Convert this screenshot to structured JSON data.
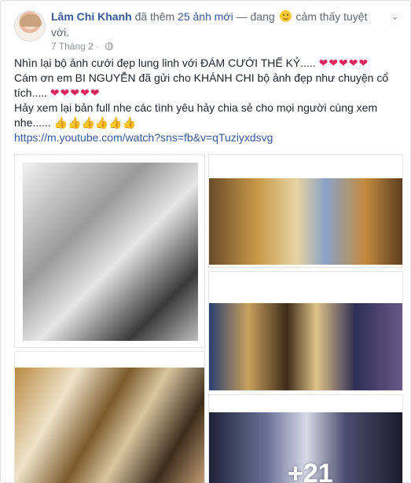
{
  "post": {
    "author": "Lâm Chi Khanh",
    "action_before": "đã thêm",
    "photo_count": "25 ảnh mới",
    "action_after": "— đang",
    "feeling": "cảm thấy tuyệt",
    "feeling_line2": "vời.",
    "date": "7 Tháng 2",
    "dot": "·",
    "chevron": "⌄",
    "icons": {
      "privacy": "globe-icon",
      "feeling": "smiley-icon",
      "menu": "chevron-down-icon"
    }
  },
  "body": {
    "line1": "Nhìn lại bộ ảnh cưới đẹp lung linh với ĐÁM CƯỚI THẾ KỶ.....",
    "line1_emoji": "❤❤❤❤❤",
    "line2": "Cám ơn em BI NGUYỄN đã gửi cho KHÁNH CHI bộ ảnh đẹp như chuyện cổ tích.....",
    "line2_emoji": "❤❤❤❤❤",
    "line3": "Hảy xem lại bản full nhe các tình yêu hảy chia sẻ cho mọi người cùng xem nhe......",
    "line3_emoji": "👍👍👍👍👍👍",
    "link": "https://m.youtube.com/watch?sns=fb&v=qTuziyxdsvg"
  },
  "gallery": {
    "more_label": "+21"
  },
  "colors": {
    "link": "#365899",
    "heart": "#e0245e",
    "meta": "#90949c"
  }
}
